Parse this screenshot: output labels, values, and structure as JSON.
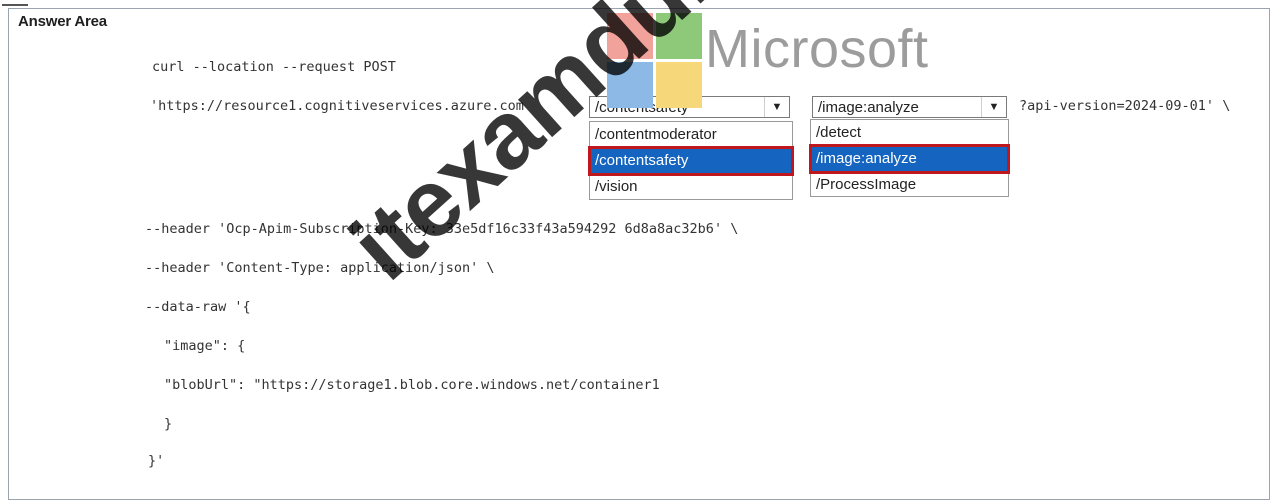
{
  "answer_area": {
    "title": "Answer Area"
  },
  "code_lines": {
    "curl": "curl --location --request POST",
    "url_prefix": "'https://resource1.cognitiveservices.azure.com",
    "url_suffix": "?api-version=2024-09-01' \\",
    "header_key": "--header 'Ocp-Apim-Subscription-Key: 33e5df16c33f43a594292 6d8a8ac32b6' \\",
    "header_ct": "--header 'Content-Type: application/json' \\",
    "data_raw": "--data-raw '{",
    "image_open": "\"image\": {",
    "blob_url": "\"blobUrl\": \"https://storage1.blob.core.windows.net/container1",
    "close_brace": "}",
    "close_json": "}'"
  },
  "dropdown1": {
    "selected": "/contentsafety",
    "options": [
      "/contentmoderator",
      "/contentsafety",
      "/vision"
    ]
  },
  "dropdown2": {
    "selected": "/image:analyze",
    "options": [
      "/detect",
      "/image:analyze",
      "/ProcessImage"
    ]
  },
  "watermark": {
    "brand": "Microsoft",
    "site": "itexamdump.com"
  },
  "colors": {
    "selected_bg": "#1565c0",
    "highlight_border": "#c0161d",
    "logo_red": "#f1a29a",
    "logo_green": "#8ec97a",
    "logo_blue": "#8cb9e6",
    "logo_yellow": "#f6d87a"
  }
}
